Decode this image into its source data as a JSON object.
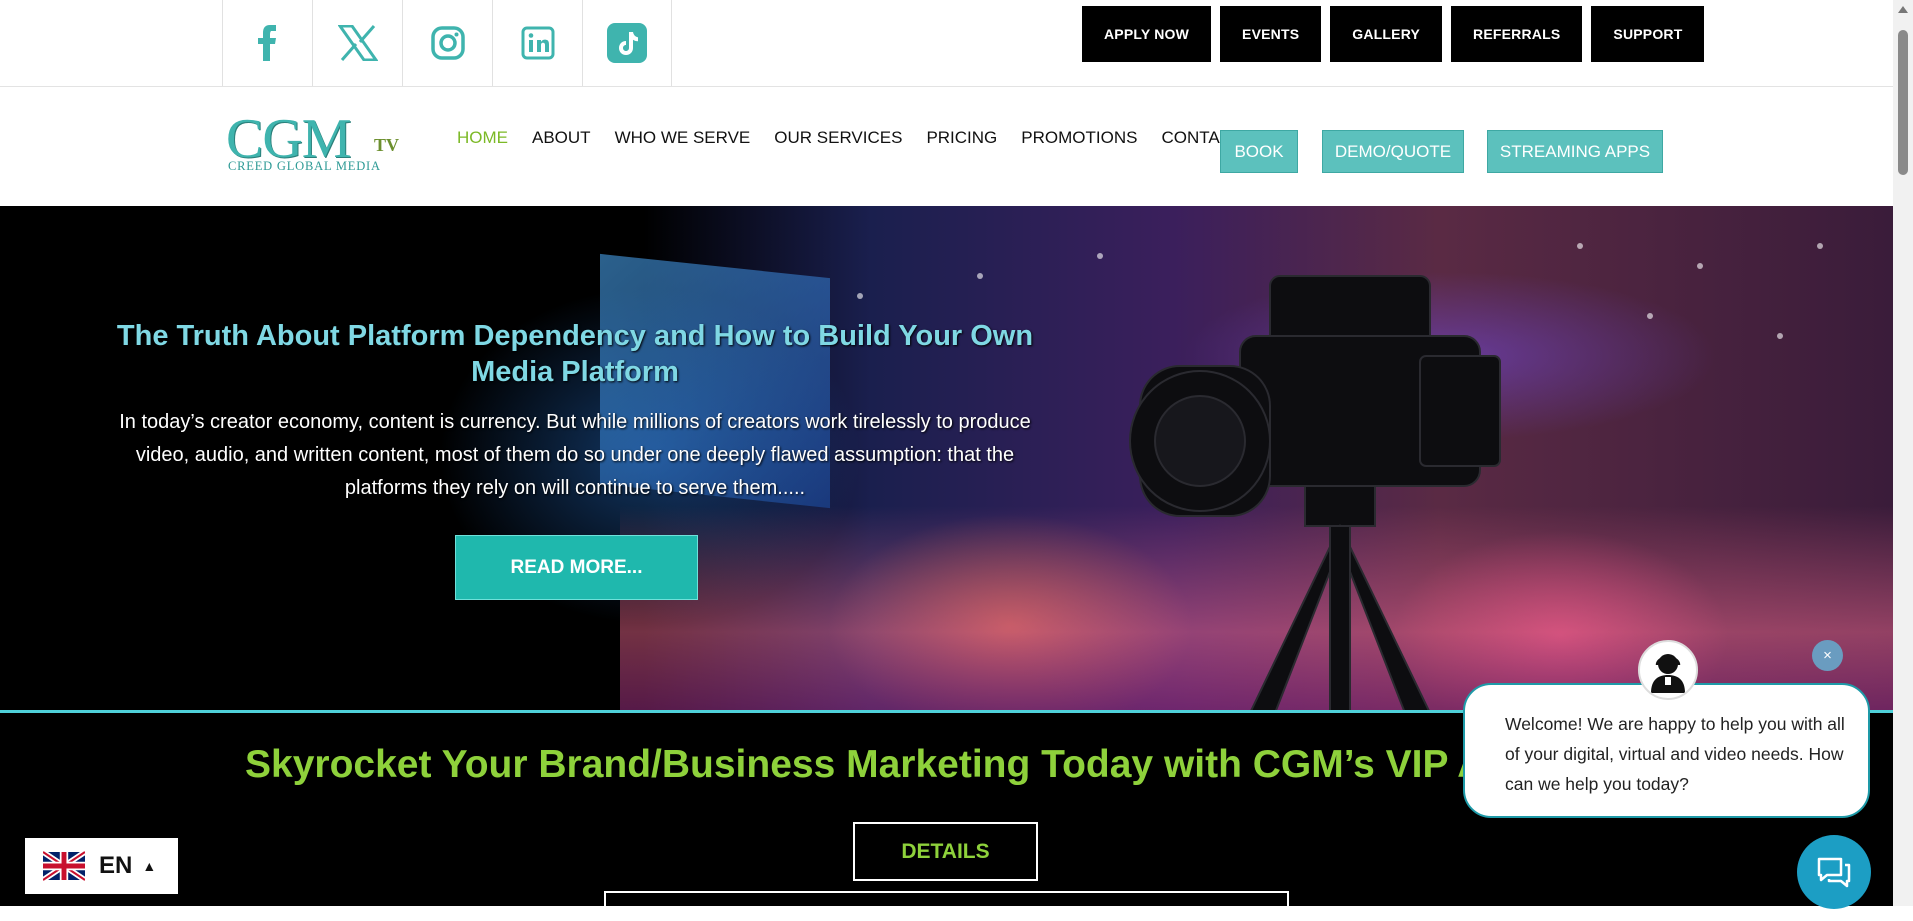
{
  "social": [
    {
      "icon": "facebook-icon",
      "glyph": "f"
    },
    {
      "icon": "x-icon",
      "glyph": "𝕏"
    },
    {
      "icon": "instagram-icon",
      "glyph": ""
    },
    {
      "icon": "linkedin-icon",
      "glyph": "in"
    },
    {
      "icon": "tiktok-icon",
      "glyph": "♪"
    }
  ],
  "top_links": [
    "APPLY NOW",
    "EVENTS",
    "GALLERY",
    "REFERRALS",
    "SUPPORT"
  ],
  "logo": {
    "main": "CGM",
    "tv": "TV",
    "sub": "CREED GLOBAL MEDIA"
  },
  "menu": {
    "items": [
      "HOME",
      "ABOUT",
      "WHO WE SERVE",
      "OUR SERVICES",
      "PRICING",
      "PROMOTIONS",
      "CONTACT"
    ],
    "active": "HOME",
    "buttons": [
      "BOOK",
      "DEMO/QUOTE",
      "STREAMING APPS"
    ]
  },
  "hero": {
    "title": "The Truth About Platform Dependency and How to Build Your Own Media Platform",
    "text": "In today’s creator economy, content is currency. But while millions of creators work tirelessly to produce video, audio, and written content, most of them do so under one deeply flawed assumption: that the platforms they rely on will continue to serve them.....",
    "cta": "READ MORE..."
  },
  "promo": {
    "title": "Skyrocket Your Brand/Business Marketing Today with CGM’s VIP A",
    "button": "DETAILS"
  },
  "language": {
    "code": "EN",
    "flag": "uk-flag-icon"
  },
  "chat": {
    "message": "Welcome! We are happy to help you with all of your digital, virtual and video needs. How can we help you today?",
    "close": "×"
  },
  "colors": {
    "accent_teal": "#5cc1bd",
    "active_green": "#7cb926",
    "promo_green": "#8ed13b",
    "hero_title": "#7fd8e4",
    "cta_teal": "#1fb8ad"
  }
}
